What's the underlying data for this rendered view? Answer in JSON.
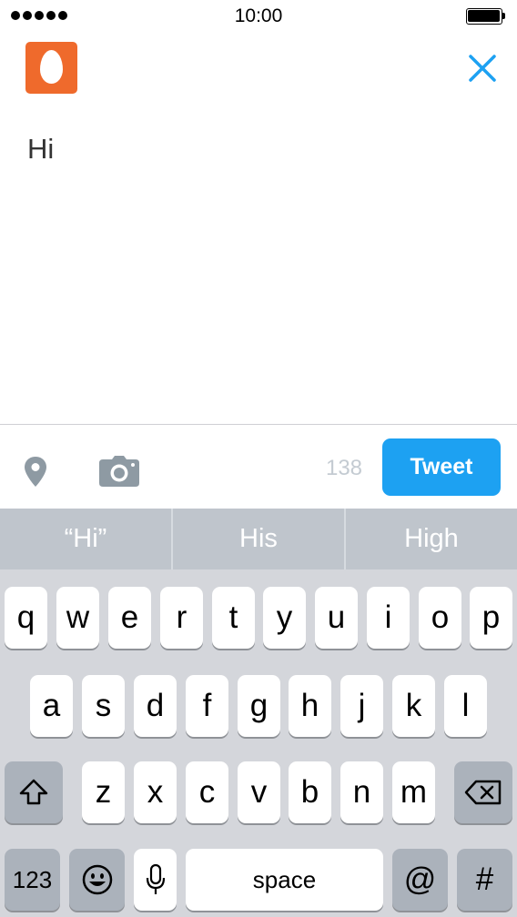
{
  "status_bar": {
    "time": "10:00"
  },
  "compose": {
    "text": "Hi"
  },
  "toolbar": {
    "char_count": "138",
    "tweet_label": "Tweet"
  },
  "predictions": [
    "“Hi”",
    "His",
    "High"
  ],
  "keyboard": {
    "row1": [
      "q",
      "w",
      "e",
      "r",
      "t",
      "y",
      "u",
      "i",
      "o",
      "p"
    ],
    "row2": [
      "a",
      "s",
      "d",
      "f",
      "g",
      "h",
      "j",
      "k",
      "l"
    ],
    "row3": [
      "z",
      "x",
      "c",
      "v",
      "b",
      "n",
      "m"
    ],
    "numbers_label": "123",
    "space_label": "space",
    "at_label": "@",
    "hash_label": "#"
  },
  "colors": {
    "accent": "#1da1f2",
    "avatar": "#ef6a2c",
    "icon_gray": "#8e9aa3"
  },
  "icons": [
    "signal-dots",
    "battery",
    "egg-avatar",
    "close-x",
    "location-pin",
    "camera",
    "shift-arrow",
    "backspace",
    "emoji-smiley",
    "microphone"
  ]
}
